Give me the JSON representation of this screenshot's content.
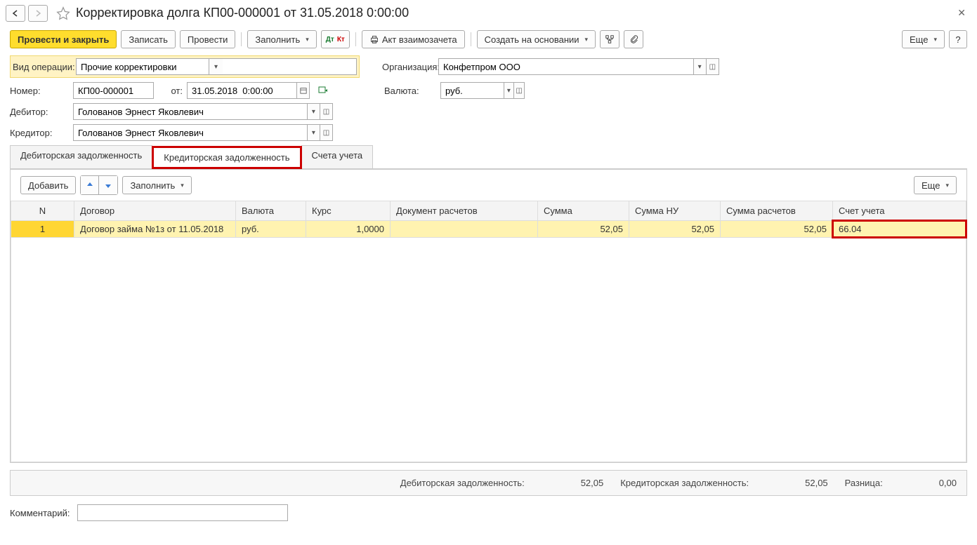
{
  "title": "Корректировка долга КП00-000001 от 31.05.2018 0:00:00",
  "toolbar": {
    "post_close": "Провести и закрыть",
    "write": "Записать",
    "post": "Провести",
    "fill": "Заполнить",
    "act": "Акт взаимозачета",
    "create_based": "Создать на основании",
    "more": "Еще"
  },
  "fields": {
    "op_type_label": "Вид операции:",
    "op_type_value": "Прочие корректировки",
    "org_label": "Организация:",
    "org_value": "Конфетпром ООО",
    "number_label": "Номер:",
    "number_value": "КП00-000001",
    "date_label": "от:",
    "date_value": "31.05.2018  0:00:00",
    "currency_label": "Валюта:",
    "currency_value": "руб.",
    "debtor_label": "Дебитор:",
    "debtor_value": "Голованов Эрнест Яковлевич",
    "creditor_label": "Кредитор:",
    "creditor_value": "Голованов Эрнест Яковлевич"
  },
  "tabs": {
    "tab1": "Дебиторская задолженность",
    "tab2": "Кредиторская задолженность",
    "tab3": "Счета учета"
  },
  "tab_toolbar": {
    "add": "Добавить",
    "fill": "Заполнить",
    "more": "Еще"
  },
  "table": {
    "headers": {
      "n": "N",
      "contract": "Договор",
      "currency": "Валюта",
      "rate": "Курс",
      "doc": "Документ расчетов",
      "sum": "Сумма",
      "sum_nu": "Сумма НУ",
      "sum_calc": "Сумма расчетов",
      "account": "Счет учета"
    },
    "rows": [
      {
        "n": "1",
        "contract": "Договор займа №1з от 11.05.2018",
        "currency": "руб.",
        "rate": "1,0000",
        "doc": "",
        "sum": "52,05",
        "sum_nu": "52,05",
        "sum_calc": "52,05",
        "account": "66.04"
      }
    ]
  },
  "totals": {
    "debit_label": "Дебиторская задолженность:",
    "debit_value": "52,05",
    "credit_label": "Кредиторская задолженность:",
    "credit_value": "52,05",
    "diff_label": "Разница:",
    "diff_value": "0,00"
  },
  "comment": {
    "label": "Комментарий:",
    "value": ""
  }
}
